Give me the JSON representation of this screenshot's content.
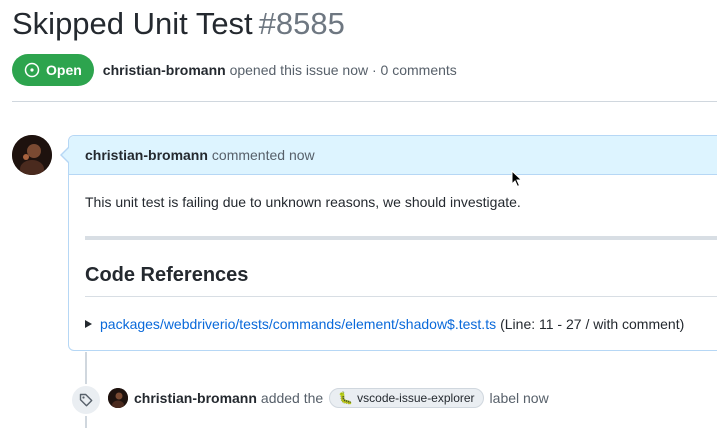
{
  "issue": {
    "title": "Skipped Unit Test",
    "number": "#8585",
    "state": "Open",
    "author": "christian-bromann",
    "opened_text": "opened this issue now · 0 comments"
  },
  "comment": {
    "author": "christian-bromann",
    "meta": "commented now",
    "body": "This unit test is failing due to unknown reasons, we should investigate.",
    "section_heading": "Code References",
    "reference": {
      "path": "packages/webdriverio/tests/commands/element/shadow$.test.ts",
      "detail": "(Line: 11 - 27 / with comment)"
    }
  },
  "event": {
    "actor": "christian-bromann",
    "action": "added the",
    "label_name": "vscode-issue-explorer",
    "suffix": "label now"
  },
  "colors": {
    "open_green": "#2da44e",
    "link_blue": "#0969da",
    "header_blue": "#ddf4ff"
  }
}
